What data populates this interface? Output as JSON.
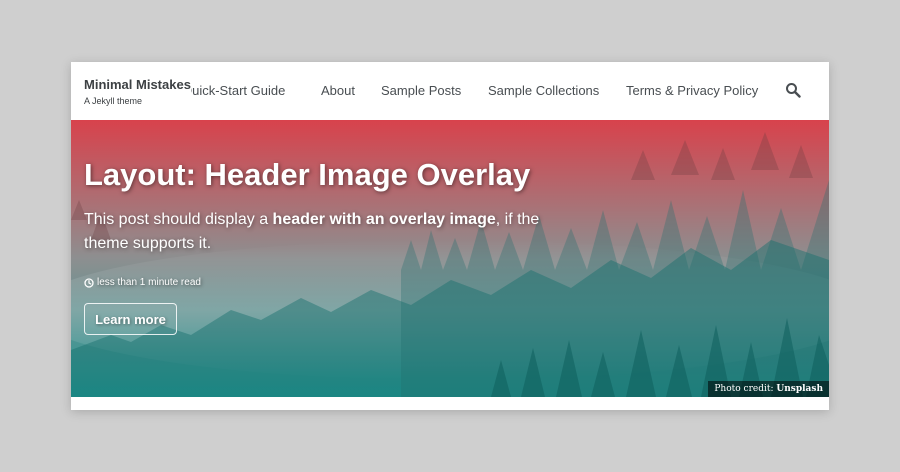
{
  "masthead": {
    "site_title": "Minimal Mistakes",
    "site_subtitle": "A Jekyll theme",
    "nav_items": [
      "Quick-Start Guide",
      "About",
      "Sample Posts",
      "Sample Collections",
      "Terms & Privacy Policy"
    ],
    "search_icon": "search-icon"
  },
  "hero": {
    "title": "Layout: Header Image Overlay",
    "excerpt_pre": "This post should display a ",
    "excerpt_bold": "header with an overlay image",
    "excerpt_post": ", if the theme supports it.",
    "read_time": "less than 1 minute read",
    "read_time_icon": "clock-icon",
    "cta_label": "Learn more",
    "photo_credit_label": "Photo credit:",
    "photo_credit_link": "Unsplash",
    "overlay_top_color": "#d9424b",
    "overlay_bottom_color": "#1f9a96"
  }
}
